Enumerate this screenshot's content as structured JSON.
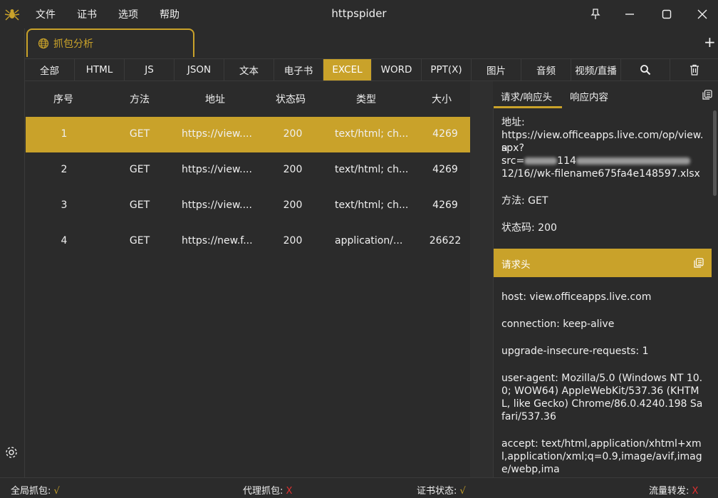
{
  "window": {
    "title": "httpspider",
    "menu": [
      "文件",
      "证书",
      "选项",
      "帮助"
    ]
  },
  "tab": {
    "label": "抓包分析",
    "add": "+"
  },
  "filters": [
    {
      "label": "全部"
    },
    {
      "label": "HTML"
    },
    {
      "label": "JS"
    },
    {
      "label": "JSON"
    },
    {
      "label": "文本"
    },
    {
      "label": "电子书"
    },
    {
      "label": "EXCEL"
    },
    {
      "label": "WORD"
    },
    {
      "label": "PPT(X)"
    },
    {
      "label": "图片"
    },
    {
      "label": "音频"
    },
    {
      "label": "视频/直播"
    }
  ],
  "active_filter": "EXCEL",
  "table": {
    "headers": [
      "序号",
      "方法",
      "地址",
      "状态码",
      "类型",
      "大小"
    ],
    "rows": [
      {
        "index": "1",
        "method": "GET",
        "url": "https://view....",
        "status": "200",
        "type": "text/html; ch...",
        "size": "4269"
      },
      {
        "index": "2",
        "method": "GET",
        "url": "https://view....",
        "status": "200",
        "type": "text/html; ch...",
        "size": "4269"
      },
      {
        "index": "3",
        "method": "GET",
        "url": "https://view....",
        "status": "200",
        "type": "text/html; ch...",
        "size": "4269"
      },
      {
        "index": "4",
        "method": "GET",
        "url": "https://new.f...",
        "status": "200",
        "type": "application/...",
        "size": "26622"
      }
    ]
  },
  "detail": {
    "tabs": [
      "请求/响应头",
      "响应内容"
    ],
    "address_label": "地址:",
    "address_line1": "https://view.officeapps.live.com/op/view.a",
    "address_line2": "spx?",
    "address_line3_prefix": "src=",
    "address_line3_mid": "114",
    "address_line4": "12/16//wk-filename675fa4e148597.xlsx",
    "method": "方法: GET",
    "status": "状态码: 200",
    "request_header_title": "请求头",
    "headers": [
      "host: view.officeapps.live.com",
      "connection: keep-alive",
      "upgrade-insecure-requests: 1",
      "user-agent: Mozilla/5.0 (Windows NT 10.0; WOW64) AppleWebKit/537.36 (KHTML, like Gecko) Chrome/86.0.4240.198 Safari/537.36",
      "accept: text/html,application/xhtml+xml,application/xml;q=0.9,image/avif,image/webp,ima"
    ]
  },
  "statusbar": {
    "global_capture": "全局抓包:",
    "global_capture_state": "√",
    "proxy_capture": "代理抓包:",
    "proxy_capture_state": "X",
    "cert_status": "证书状态:",
    "cert_status_state": "√",
    "traffic_forward": "流量转发:",
    "traffic_forward_state": "X"
  },
  "colors": {
    "accent": "#c9a22a",
    "background": "#2b2b2b",
    "error": "#e03030"
  },
  "icons": [
    "spider-icon",
    "pin-icon",
    "minimize-icon",
    "maximize-icon",
    "close-icon",
    "globe-icon",
    "search-icon",
    "trash-icon",
    "copy-icon",
    "settings-gear-icon"
  ]
}
